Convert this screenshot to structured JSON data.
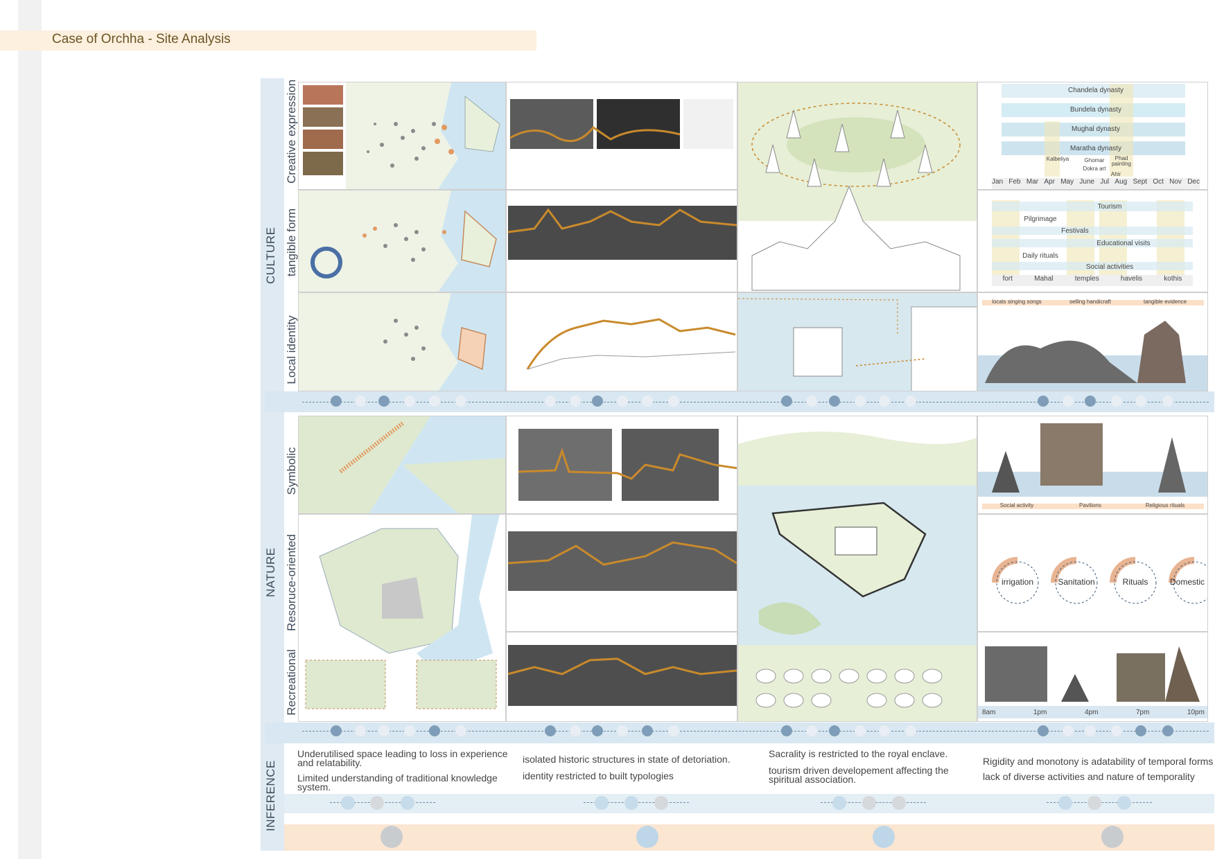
{
  "title": "Case of Orchha - Site Analysis",
  "sections": {
    "culture": "CULTURE",
    "nature": "NATURE",
    "inference": "INFERENCE"
  },
  "row_labels": {
    "creative": "Creative expression",
    "tangible": "tangible form",
    "local": "Local identity",
    "symbolic": "Symbolic",
    "resource": "Resoruce-oriented",
    "recreational": "Recreational"
  },
  "dynasty_chart": {
    "dynasties": [
      "Chandela dynasty",
      "Bundela dynasty",
      "Mughal dynasty",
      "Maratha dynasty"
    ],
    "arts": [
      "Kalbeliya",
      "Ghomar",
      "Dokra art",
      "Ahir",
      "Phad painting"
    ],
    "months": [
      "Jan",
      "Feb",
      "Mar",
      "Apr",
      "May",
      "June",
      "Jul",
      "Aug",
      "Sept",
      "Oct",
      "Nov",
      "Dec"
    ]
  },
  "activity_chart": {
    "activities": [
      "Tourism",
      "Pilgrimage",
      "Festivals",
      "Educational visits",
      "Daily rituals",
      "Social activities"
    ],
    "places": [
      "fort",
      "Mahal",
      "temples",
      "havelis",
      "kothis"
    ]
  },
  "local_tags": [
    "locals singing songs",
    "selling handicraft",
    "tangible evidence"
  ],
  "symbolic_tags": [
    "Social activity",
    "Pavilions",
    "Religious rituals"
  ],
  "resource_circles": [
    "irrigation",
    "Sanitation",
    "Rituals",
    "Domestic"
  ],
  "times": [
    "8am",
    "1pm",
    "4pm",
    "7pm",
    "10pm"
  ],
  "inferences": [
    {
      "a": "Underutilised space leading to loss in experience and relatability.",
      "b": "Limited understanding of traditional knowledge system."
    },
    {
      "a": "isolated historic structures in state of detoriation.",
      "b": "identity restricted to built typologies"
    },
    {
      "a": "Sacrality is restricted to the royal enclave.",
      "b": "tourism driven developement affecting the spiritual association."
    },
    {
      "a": "Rigidity and monotony is adatability of temporal forms",
      "b": "lack of diverse activities and nature of temporality"
    }
  ],
  "colors": {
    "accent_orange": "#e39a62",
    "map_green": "#dfe9cf",
    "water_blue": "#cfe6f2",
    "band_blue": "#d8e7f1",
    "band_peach": "#fbe6d2",
    "title_text": "#6b5423"
  }
}
